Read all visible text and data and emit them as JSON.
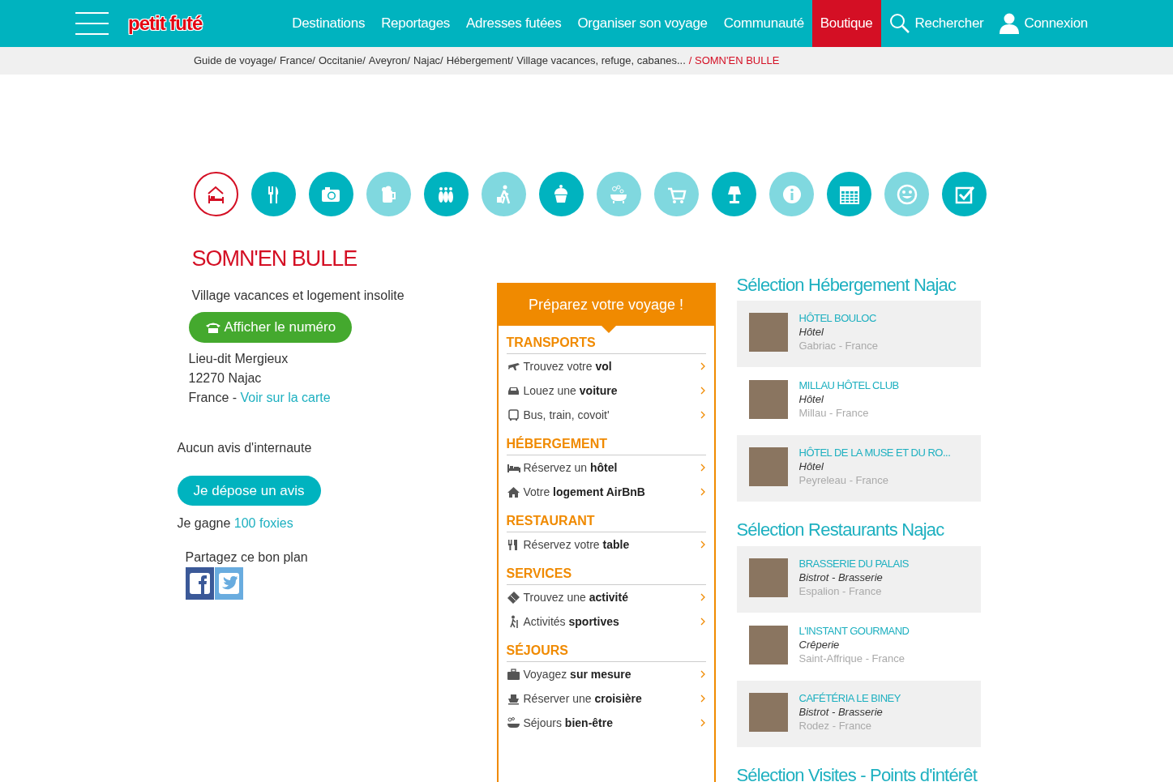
{
  "header": {
    "logo": "petit futé",
    "nav": [
      {
        "label": "Destinations",
        "highlighted": false
      },
      {
        "label": "Reportages",
        "highlighted": false
      },
      {
        "label": "Adresses futées",
        "highlighted": false
      },
      {
        "label": "Organiser son voyage",
        "highlighted": false
      },
      {
        "label": "Communauté",
        "highlighted": false
      },
      {
        "label": "Boutique",
        "highlighted": true
      }
    ],
    "search": "Rechercher",
    "login": "Connexion"
  },
  "breadcrumb": [
    {
      "label": "Guide de voyage/",
      "current": false
    },
    {
      "label": "France/",
      "current": false
    },
    {
      "label": "Occitanie/",
      "current": false
    },
    {
      "label": "Aveyron/",
      "current": false
    },
    {
      "label": "Najac/",
      "current": false
    },
    {
      "label": "Hébergement/",
      "current": false
    },
    {
      "label": "Village vacances, refuge, cabanes...",
      "current": false
    },
    {
      "label": "/ SOMN'EN BULLE",
      "current": true
    }
  ],
  "categories": [
    {
      "kind": "bed",
      "selected": true,
      "color": "#d40f24"
    },
    {
      "kind": "cutlery",
      "selected": false,
      "color": "#00b3bf"
    },
    {
      "kind": "camera",
      "selected": false,
      "color": "#00b3bf"
    },
    {
      "kind": "beer",
      "selected": false,
      "color": "#80d8df"
    },
    {
      "kind": "bowling",
      "selected": false,
      "color": "#00b3bf"
    },
    {
      "kind": "traveler",
      "selected": false,
      "color": "#80d8df"
    },
    {
      "kind": "cupcake",
      "selected": false,
      "color": "#00b3bf"
    },
    {
      "kind": "bath",
      "selected": false,
      "color": "#80d8df"
    },
    {
      "kind": "cart",
      "selected": false,
      "color": "#80d8df"
    },
    {
      "kind": "lamp",
      "selected": false,
      "color": "#00b3bf"
    },
    {
      "kind": "info",
      "selected": false,
      "color": "#80d8df"
    },
    {
      "kind": "calendar",
      "selected": false,
      "color": "#00b3bf"
    },
    {
      "kind": "smiley",
      "selected": false,
      "color": "#80d8df"
    },
    {
      "kind": "checkbox",
      "selected": false,
      "color": "#00b3bf"
    }
  ],
  "place": {
    "title": "SOMN'EN BULLE",
    "subtitle": "Village vacances et logement insolite",
    "phone_button": "Afficher le numéro",
    "address": [
      "Lieu-dit Mergieux",
      "12270 Najac"
    ],
    "country": "France -",
    "map_link": "Voir sur la carte",
    "reviews": "Aucun avis d'internaute",
    "review_button": "Je dépose un avis",
    "reward_text": "Je gagne",
    "reward_link": "100 foxies",
    "share_label": "Partagez ce bon plan"
  },
  "trip": {
    "title": "Préparez votre voyage !",
    "sections": [
      {
        "heading": "TRANSPORTS",
        "items": [
          {
            "kind": "plane",
            "text": "Trouvez votre **vol**"
          },
          {
            "kind": "car",
            "text": "Louez une **voiture**"
          },
          {
            "kind": "bus",
            "text": "Bus, train, covoit'"
          }
        ]
      },
      {
        "heading": "HÉBERGEMENT",
        "items": [
          {
            "kind": "bed",
            "text": "Réservez un **hôtel**"
          },
          {
            "kind": "house",
            "text": "Votre **logement AirBnB**"
          }
        ]
      },
      {
        "heading": "RESTAURANT",
        "items": [
          {
            "kind": "cutlery",
            "text": "Réservez votre **table**"
          }
        ]
      },
      {
        "heading": "SERVICES",
        "items": [
          {
            "kind": "ticket",
            "text": "Trouvez une **activité**"
          },
          {
            "kind": "hiker",
            "text": "Activités **sportives**"
          }
        ]
      },
      {
        "heading": "SÉJOURS",
        "items": [
          {
            "kind": "suitcase",
            "text": "Voyagez **sur mesure**"
          },
          {
            "kind": "ship",
            "text": "Réserver une **croisière**"
          },
          {
            "kind": "bath",
            "text": "Séjours **bien-être**"
          }
        ]
      }
    ]
  },
  "selections": [
    {
      "heading": "Sélection Hébergement Najac",
      "entries": [
        {
          "name": "HÔTEL BOULOC",
          "category": "Hôtel",
          "location": "Gabriac - France"
        },
        {
          "name": "MILLAU HÔTEL CLUB",
          "category": "Hôtel",
          "location": "Millau - France"
        },
        {
          "name": "HÔTEL DE LA MUSE ET DU RO...",
          "category": "Hôtel",
          "location": "Peyreleau - France"
        }
      ]
    },
    {
      "heading": "Sélection Restaurants Najac",
      "entries": [
        {
          "name": "BRASSERIE DU PALAIS",
          "category": "Bistrot - Brasserie",
          "location": "Espalion - France"
        },
        {
          "name": "L'INSTANT GOURMAND",
          "category": "Crêperie",
          "location": "Saint-Affrique - France"
        },
        {
          "name": "CAFÉTÉRIA LE BINEY",
          "category": "Bistrot - Brasserie",
          "location": "Rodez - France"
        }
      ]
    },
    {
      "heading": "Sélection Visites - Points d'intérêt"
    }
  ]
}
